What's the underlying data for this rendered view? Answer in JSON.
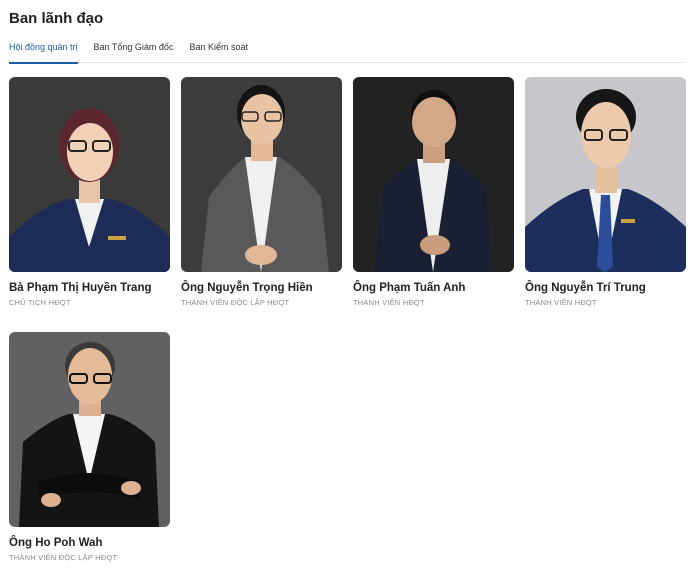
{
  "header": {
    "title": "Ban lãnh đạo"
  },
  "tabs": [
    {
      "label": "Hội đồng quản trị",
      "active": true
    },
    {
      "label": "Ban Tổng Giám đốc",
      "active": false
    },
    {
      "label": "Ban Kiểm soát",
      "active": false
    }
  ],
  "members": [
    {
      "name": "Bà Phạm Thị Huyền Trang",
      "role": "CHỦ TỊCH HĐQT"
    },
    {
      "name": "Ông Nguyễn Trọng Hiền",
      "role": "THÀNH VIÊN ĐỘC LẬP HĐQT"
    },
    {
      "name": "Ông Phạm Tuấn Anh",
      "role": "THÀNH VIÊN HĐQT"
    },
    {
      "name": "Ông Nguyễn Trí Trung",
      "role": "THÀNH VIÊN HĐQT"
    },
    {
      "name": "Ông Ho Poh Wah",
      "role": "THÀNH VIÊN ĐỘC LẬP HĐQT"
    }
  ],
  "colors": {
    "accent": "#1b5fa8",
    "role_text": "#8a8a8a"
  }
}
